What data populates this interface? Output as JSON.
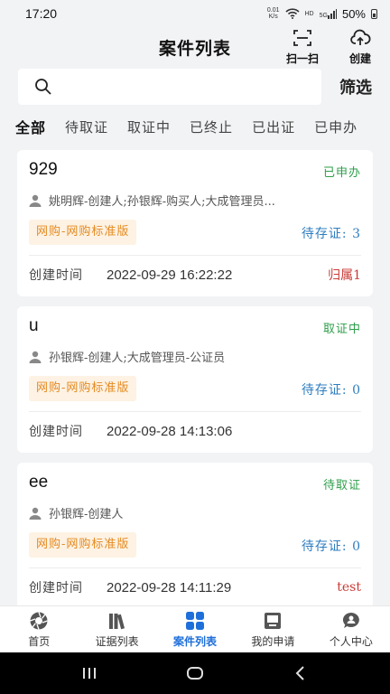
{
  "status_bar": {
    "time": "17:20",
    "net_speed": "0.01",
    "net_unit": "K/s",
    "hd": "HD",
    "signal_label": "5G",
    "battery": "50%"
  },
  "header": {
    "title": "案件列表",
    "scan_label": "扫一扫",
    "create_label": "创建"
  },
  "search": {
    "placeholder": "",
    "filter_label": "筛选"
  },
  "tabs": [
    {
      "label": "全部",
      "active": true
    },
    {
      "label": "待取证"
    },
    {
      "label": "取证中"
    },
    {
      "label": "已终止"
    },
    {
      "label": "已出证"
    },
    {
      "label": "已申办"
    }
  ],
  "cases": [
    {
      "title": "929",
      "status": "已申办",
      "people": "姚明辉-创建人;孙银辉-购买人;大成管理员...",
      "tag": "网购-网购标准版",
      "pending": "待存证: 3",
      "time_label": "创建时间",
      "time": "2022-09-29 16:22:22",
      "belong": "归属1"
    },
    {
      "title": "u",
      "status": "取证中",
      "people": "孙银辉-创建人;大成管理员-公证员",
      "tag": "网购-网购标准版",
      "pending": "待存证: 0",
      "time_label": "创建时间",
      "time": "2022-09-28 14:13:06",
      "belong": ""
    },
    {
      "title": "ee",
      "status": "待取证",
      "people": "孙银辉-创建人",
      "tag": "网购-网购标准版",
      "pending": "待存证: 0",
      "time_label": "创建时间",
      "time": "2022-09-28 14:11:29",
      "belong": "test"
    }
  ],
  "bottom_nav": [
    {
      "label": "首页",
      "icon": "camera-aperture-icon"
    },
    {
      "label": "证据列表",
      "icon": "books-icon"
    },
    {
      "label": "案件列表",
      "icon": "grid-icon",
      "active": true
    },
    {
      "label": "我的申请",
      "icon": "inbox-icon"
    },
    {
      "label": "个人中心",
      "icon": "chat-person-icon"
    }
  ],
  "colors": {
    "accent": "#1e6fd9",
    "status_green": "#2e9e4a",
    "tag_orange": "#e58b22",
    "pending_blue": "#2e7dbf",
    "belong_red": "#c93b35"
  }
}
